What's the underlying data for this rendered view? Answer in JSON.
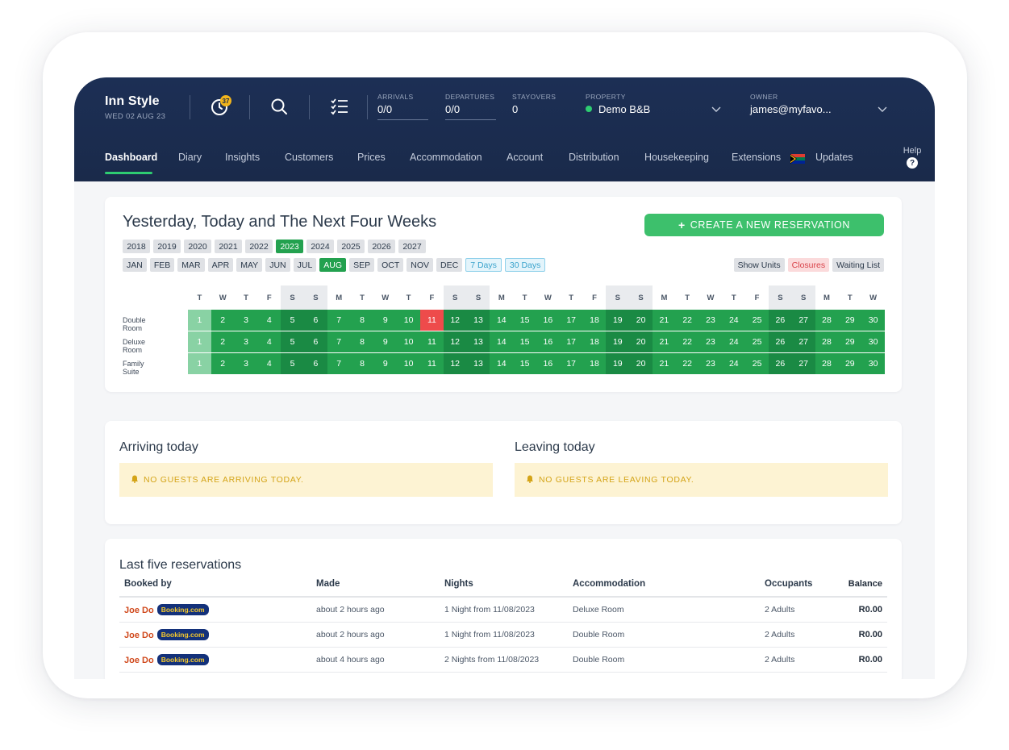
{
  "header": {
    "brand": "Inn Style",
    "date": "WED 02 AUG 23",
    "notifications_count": "37",
    "arrivals": {
      "label": "ARRIVALS",
      "value": "0/0"
    },
    "departures": {
      "label": "DEPARTURES",
      "value": "0/0"
    },
    "stayovers": {
      "label": "STAYOVERS",
      "value": "0"
    },
    "property": {
      "label": "PROPERTY",
      "value": "Demo B&B"
    },
    "owner": {
      "label": "OWNER",
      "value": "james@myfavo..."
    }
  },
  "nav": {
    "items": [
      "Dashboard",
      "Diary",
      "Insights",
      "Customers",
      "Prices",
      "Accommodation",
      "Account",
      "Distribution",
      "Housekeeping",
      "Extensions",
      "Updates"
    ],
    "active": "Dashboard",
    "help": "Help",
    "help_symbol": "?"
  },
  "calendar": {
    "title": "Yesterday, Today and The Next Four Weeks",
    "create_button": "CREATE A NEW RESERVATION",
    "years": [
      "2018",
      "2019",
      "2020",
      "2021",
      "2022",
      "2023",
      "2024",
      "2025",
      "2026",
      "2027"
    ],
    "active_year": "2023",
    "months": [
      "JAN",
      "FEB",
      "MAR",
      "APR",
      "MAY",
      "JUN",
      "JUL",
      "AUG",
      "SEP",
      "OCT",
      "NOV",
      "DEC"
    ],
    "active_month": "AUG",
    "range_options": [
      "7 Days",
      "30 Days"
    ],
    "filters": [
      "Show Units",
      "Closures",
      "Waiting List"
    ],
    "weekdays": [
      "T",
      "W",
      "T",
      "F",
      "S",
      "S",
      "M",
      "T",
      "W",
      "T",
      "F",
      "S",
      "S",
      "M",
      "T",
      "W",
      "T",
      "F",
      "S",
      "S",
      "M",
      "T",
      "W",
      "T",
      "F",
      "S",
      "S",
      "M",
      "T",
      "W"
    ],
    "days": [
      "1",
      "2",
      "3",
      "4",
      "5",
      "6",
      "7",
      "8",
      "9",
      "10",
      "11",
      "12",
      "13",
      "14",
      "15",
      "16",
      "17",
      "18",
      "19",
      "20",
      "21",
      "22",
      "23",
      "24",
      "25",
      "26",
      "27",
      "28",
      "29",
      "30"
    ],
    "rooms": [
      {
        "name": "Double Room",
        "closed_days": [
          "11"
        ]
      },
      {
        "name": "Deluxe Room",
        "closed_days": []
      },
      {
        "name": "Family Suite",
        "closed_days": []
      }
    ],
    "status_colors": {
      "past": "#89d2a4",
      "available": "#23a14f",
      "weekend": "#1a8a44",
      "closed": "#ee4b4b"
    }
  },
  "arriving": {
    "title": "Arriving today",
    "message": "NO GUESTS ARE ARRIVING TODAY."
  },
  "leaving": {
    "title": "Leaving today",
    "message": "NO GUESTS ARE LEAVING TODAY."
  },
  "reservations": {
    "title": "Last five reservations",
    "columns": [
      "Booked by",
      "Made",
      "Nights",
      "Accommodation",
      "Occupants",
      "Balance"
    ],
    "rows": [
      {
        "guest": "Joe Do",
        "source": "Booking.com",
        "made": "about 2 hours ago",
        "nights": "1 Night from 11/08/2023",
        "accommodation": "Deluxe Room",
        "occupants": "2 Adults",
        "balance": "R0.00"
      },
      {
        "guest": "Joe Do",
        "source": "Booking.com",
        "made": "about 2 hours ago",
        "nights": "1 Night from 11/08/2023",
        "accommodation": "Double Room",
        "occupants": "2 Adults",
        "balance": "R0.00"
      },
      {
        "guest": "Joe Do",
        "source": "Booking.com",
        "made": "about 4 hours ago",
        "nights": "2 Nights from 11/08/2023",
        "accommodation": "Double Room",
        "occupants": "2 Adults",
        "balance": "R0.00"
      }
    ]
  },
  "icons": [
    "notifications-icon",
    "search-icon",
    "checklist-icon",
    "chevron-down-icon",
    "flag-icon",
    "bell-icon",
    "plus-icon",
    "help-icon"
  ]
}
